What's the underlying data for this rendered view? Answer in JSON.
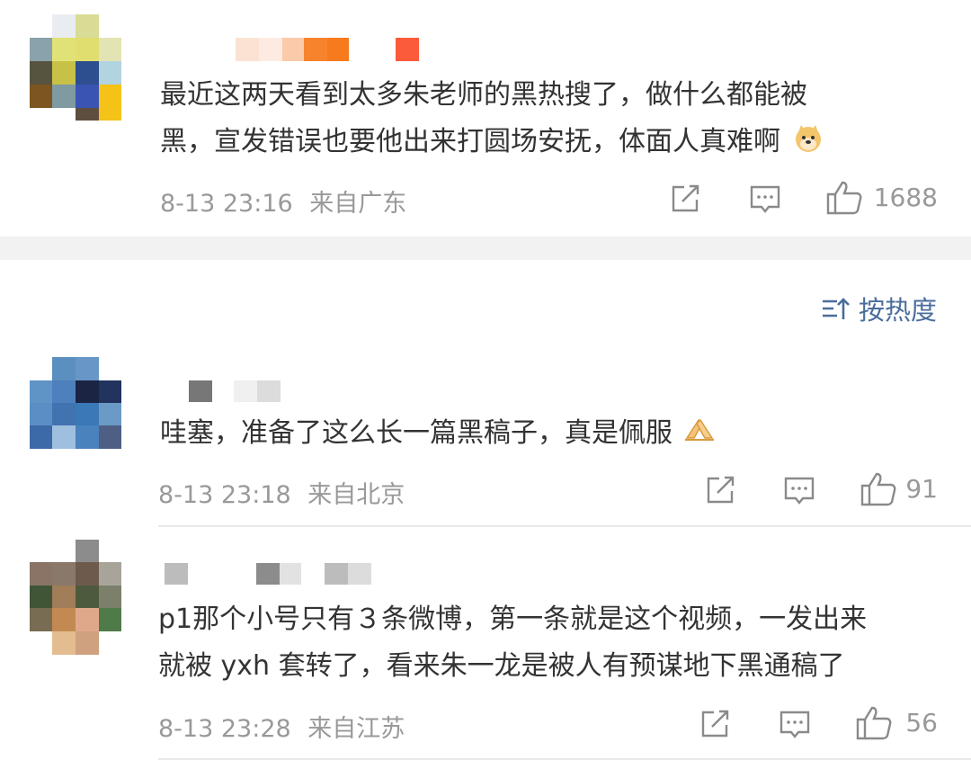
{
  "sort": {
    "label": "按热度",
    "icon": "sort-icon"
  },
  "comments": [
    {
      "text_lines": [
        "最近这两天看到太多朱老师的黑热搜了，做什么都能被",
        "黑，宣发错误也要他出来打圆场安抚，体面人真难啊"
      ],
      "emoji": "doge-emoji",
      "time": "8-13 23:16",
      "location": "来自广东",
      "likes": "1688"
    },
    {
      "text_lines": [
        "哇塞，准备了这么长一篇黑稿子，真是佩服"
      ],
      "emoji": "clasped-hands-emoji",
      "time": "8-13 23:18",
      "location": "来自北京",
      "likes": "91"
    },
    {
      "text_lines": [
        "p1那个小号只有３条微博，第一条就是这个视频，一发出来",
        "就被 yxh 套转了，看来朱一龙是被人有预谋地下黑通稿了"
      ],
      "time": "8-13 23:28",
      "location": "来自江苏",
      "likes": "56"
    }
  ],
  "colors": {
    "meta": "#999999",
    "text": "#333333",
    "sort": "#4a6d9c",
    "gap": "#f2f2f2"
  }
}
